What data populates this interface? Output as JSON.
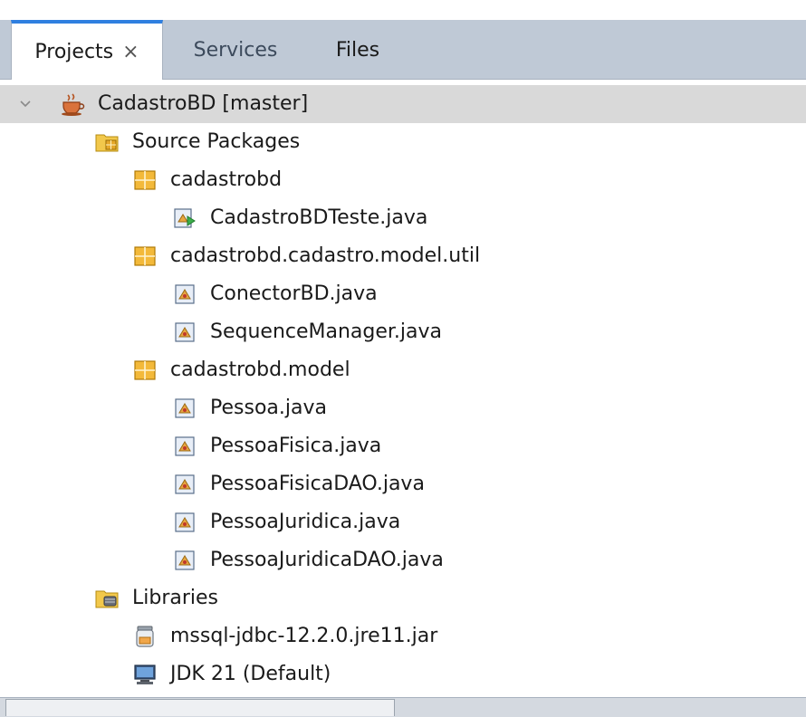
{
  "tabs": [
    {
      "label": "Projects",
      "active": true,
      "close": "×"
    },
    {
      "label": "Services",
      "active": false
    },
    {
      "label": "Files",
      "active": false
    }
  ],
  "tree": [
    {
      "label": "CadastroBD [master]",
      "icon": "coffee-cup-icon",
      "depth": 0,
      "expanded": true,
      "selected": true
    },
    {
      "label": "Source Packages",
      "icon": "folder-packages-icon",
      "depth": 1,
      "expanded": true
    },
    {
      "label": "cadastrobd",
      "icon": "package-icon",
      "depth": 2,
      "expanded": true
    },
    {
      "label": "CadastroBDTeste.java",
      "icon": "java-main-class-icon",
      "depth": 3
    },
    {
      "label": "cadastrobd.cadastro.model.util",
      "icon": "package-icon",
      "depth": 2,
      "expanded": true
    },
    {
      "label": "ConectorBD.java",
      "icon": "java-class-icon",
      "depth": 3
    },
    {
      "label": "SequenceManager.java",
      "icon": "java-class-icon",
      "depth": 3
    },
    {
      "label": "cadastrobd.model",
      "icon": "package-icon",
      "depth": 2,
      "expanded": true
    },
    {
      "label": "Pessoa.java",
      "icon": "java-class-icon",
      "depth": 3
    },
    {
      "label": "PessoaFisica.java",
      "icon": "java-class-icon",
      "depth": 3
    },
    {
      "label": "PessoaFisicaDAO.java",
      "icon": "java-class-icon",
      "depth": 3
    },
    {
      "label": "PessoaJuridica.java",
      "icon": "java-class-icon",
      "depth": 3
    },
    {
      "label": "PessoaJuridicaDAO.java",
      "icon": "java-class-icon",
      "depth": 3
    },
    {
      "label": "Libraries",
      "icon": "folder-libraries-icon",
      "depth": 1,
      "expanded": true
    },
    {
      "label": "mssql-jdbc-12.2.0.jre11.jar",
      "icon": "jar-icon",
      "depth": 2,
      "expanded": false
    },
    {
      "label": "JDK 21 (Default)",
      "icon": "jdk-icon",
      "depth": 2,
      "expanded": false
    }
  ],
  "colors": {
    "tabbar": "#bfc9d6",
    "active_tab_accent": "#2f7fe0",
    "selection": "#d9d9d9",
    "package": "#e5a82a",
    "folder": "#f2c84b"
  }
}
